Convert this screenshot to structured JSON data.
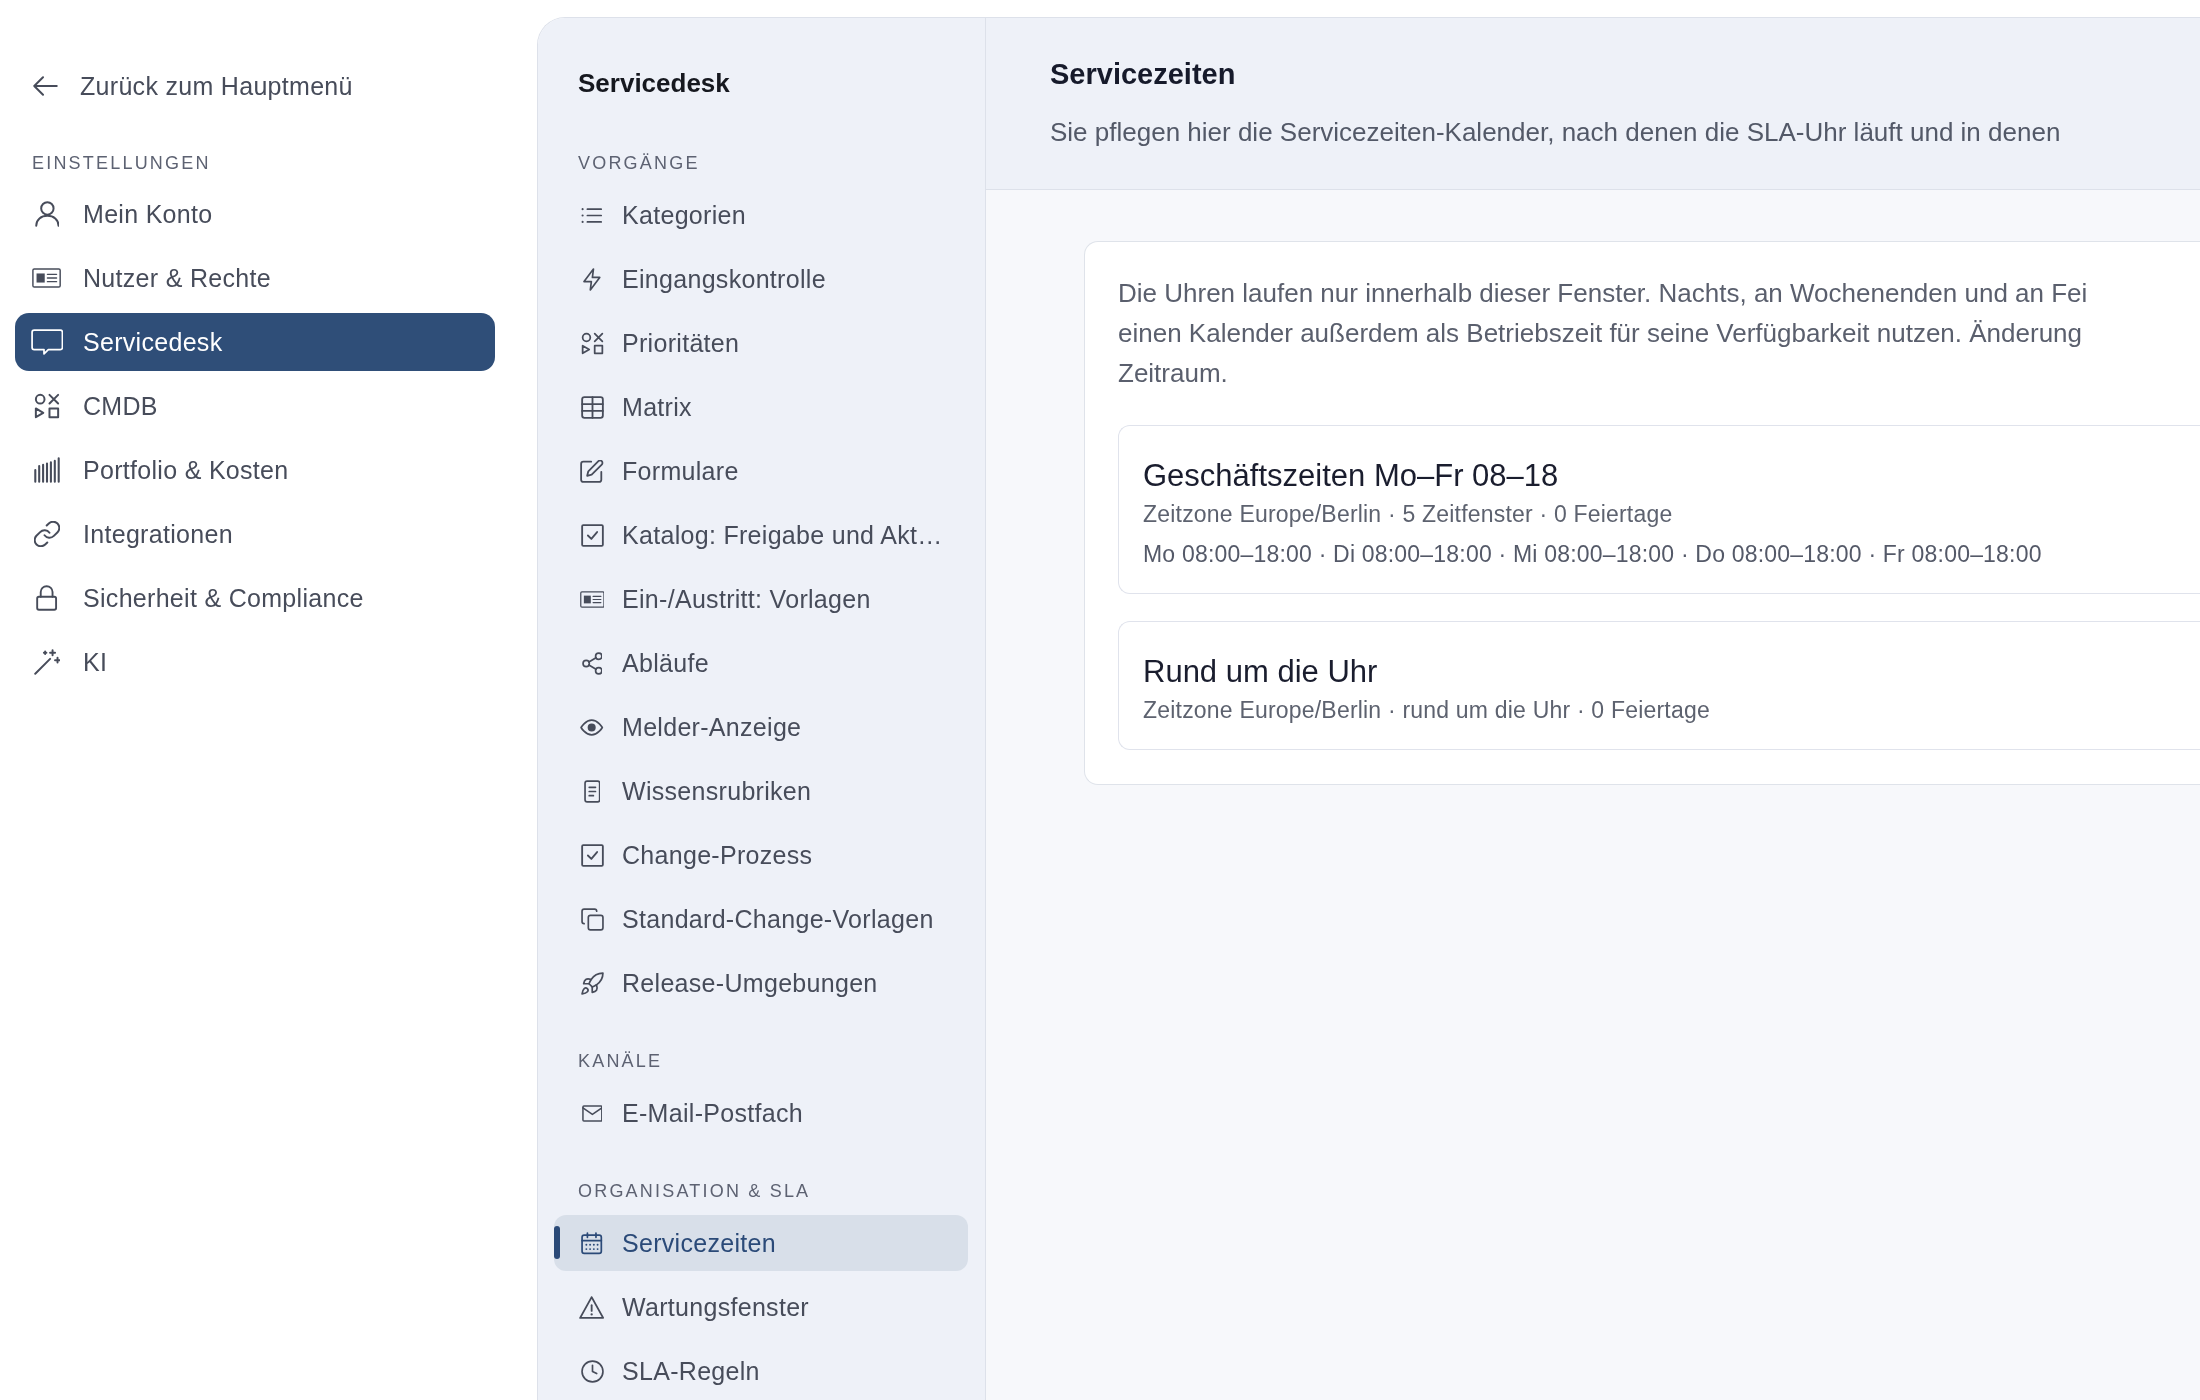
{
  "settings_sidebar": {
    "back_link": "Zurück zum Hauptmenü",
    "section_title": "EINSTELLUNGEN",
    "items": [
      {
        "label": "Mein Konto",
        "selected": false
      },
      {
        "label": "Nutzer & Rechte",
        "selected": false
      },
      {
        "label": "Servicedesk",
        "selected": true
      },
      {
        "label": "CMDB",
        "selected": false
      },
      {
        "label": "Portfolio & Kosten",
        "selected": false
      },
      {
        "label": "Integrationen",
        "selected": false
      },
      {
        "label": "Sicherheit & Compliance",
        "selected": false
      },
      {
        "label": "KI",
        "selected": false
      }
    ]
  },
  "servicedesk_nav": {
    "title": "Servicedesk",
    "sections": [
      {
        "title": "VORGÄNGE",
        "items": [
          {
            "label": "Kategorien",
            "selected": false
          },
          {
            "label": "Eingangskontrolle",
            "selected": false
          },
          {
            "label": "Prioritäten",
            "selected": false
          },
          {
            "label": "Matrix",
            "selected": false
          },
          {
            "label": "Formulare",
            "selected": false
          },
          {
            "label": "Katalog: Freigabe und Akt…",
            "selected": false
          },
          {
            "label": "Ein-/Austritt: Vorlagen",
            "selected": false
          },
          {
            "label": "Abläufe",
            "selected": false
          },
          {
            "label": "Melder-Anzeige",
            "selected": false
          },
          {
            "label": "Wissensrubriken",
            "selected": false
          },
          {
            "label": "Change-Prozess",
            "selected": false
          },
          {
            "label": "Standard-Change-Vorlagen",
            "selected": false
          },
          {
            "label": "Release-Umgebungen",
            "selected": false
          }
        ]
      },
      {
        "title": "KANÄLE",
        "items": [
          {
            "label": "E-Mail-Postfach",
            "selected": false
          }
        ]
      },
      {
        "title": "ORGANISATION & SLA",
        "items": [
          {
            "label": "Servicezeiten",
            "selected": true
          },
          {
            "label": "Wartungsfenster",
            "selected": false
          },
          {
            "label": "SLA-Regeln",
            "selected": false
          }
        ]
      }
    ]
  },
  "page_header": {
    "title": "Servicezeiten",
    "subtitle": "Sie pflegen hier die Servicezeiten-Kalender, nach denen die SLA-Uhr läuft und in denen"
  },
  "calendars_panel": {
    "description_lines": [
      "Die Uhren laufen nur innerhalb dieser Fenster. Nachts, an Wochenenden und an Fei",
      "einen Kalender außerdem als Betriebszeit für seine Verfügbarkeit nutzen. Änderung",
      "Zeitraum."
    ],
    "calendars": [
      {
        "name": "Geschäftszeiten Mo–Fr 08–18",
        "meta": "Zeitzone Europe/Berlin · 5 Zeitfenster · 0 Feiertage",
        "schedule": "Mo 08:00–18:00 · Di 08:00–18:00 · Mi 08:00–18:00 · Do 08:00–18:00 · Fr 08:00–18:00"
      },
      {
        "name": "Rund um die Uhr",
        "meta": "Zeitzone Europe/Berlin · rund um die Uhr · 0 Feiertage"
      }
    ]
  }
}
